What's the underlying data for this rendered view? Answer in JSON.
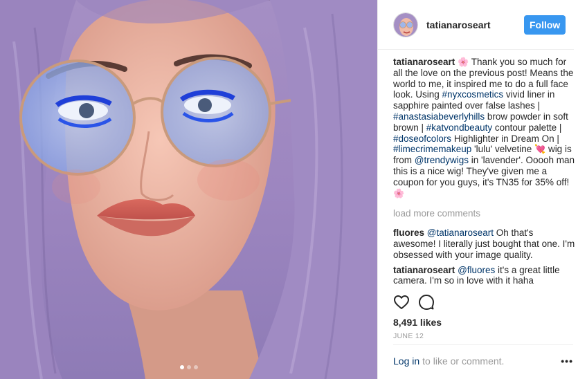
{
  "header": {
    "username": "tatianaroseart",
    "follow_label": "Follow"
  },
  "caption": {
    "username": "tatianaroseart",
    "emoji_1": "🌸",
    "t1": " Thank you so much for all the love on the previous post! Means the world to me, it inspired me to do a full face look. Using ",
    "tag_nyx": "#nyxcosmetics",
    "t2": " vivid liner in sapphire painted over false lashes | ",
    "tag_abh": "#anastasiabeverlyhills",
    "t3": " brow powder in soft brown | ",
    "tag_kvd": "#katvondbeauty",
    "t4": " contour palette | ",
    "tag_doc": "#doseofcolors",
    "t5": " Highlighter in Dream On | ",
    "tag_lime": "#limecrimemakeup",
    "t6": " 'lulu' velvetine ",
    "emoji_2": "💘",
    "t7": " wig is from ",
    "mention_trendy": "@trendywigs",
    "t8": " in 'lavender'. Ooooh man this is a nice wig! They've given me a coupon for you guys, it's TN35 for 35% off! ",
    "emoji_3": "🌸"
  },
  "load_more": "load more comments",
  "comments": [
    {
      "username": "fluores",
      "mention": "@tatianaroseart",
      "text": " Oh that's awesome! I literally just bought that one. I'm obsessed with your image quality."
    },
    {
      "username": "tatianaroseart",
      "mention": "@fluores",
      "text": " it's a great little camera. I'm so in love with it haha"
    }
  ],
  "icons": {
    "like": "heart-icon",
    "comment": "comment-bubble-icon",
    "more": "more-options-icon"
  },
  "likes": "8,491 likes",
  "date": "JUNE 12",
  "footer": {
    "login": "Log in",
    "rest": "to like or comment.",
    "more": "•••"
  },
  "carousel": {
    "count": 3,
    "active_index": 0
  },
  "colors": {
    "follow_button": "#3897f0",
    "hashtag": "#003569",
    "muted": "#999999"
  }
}
